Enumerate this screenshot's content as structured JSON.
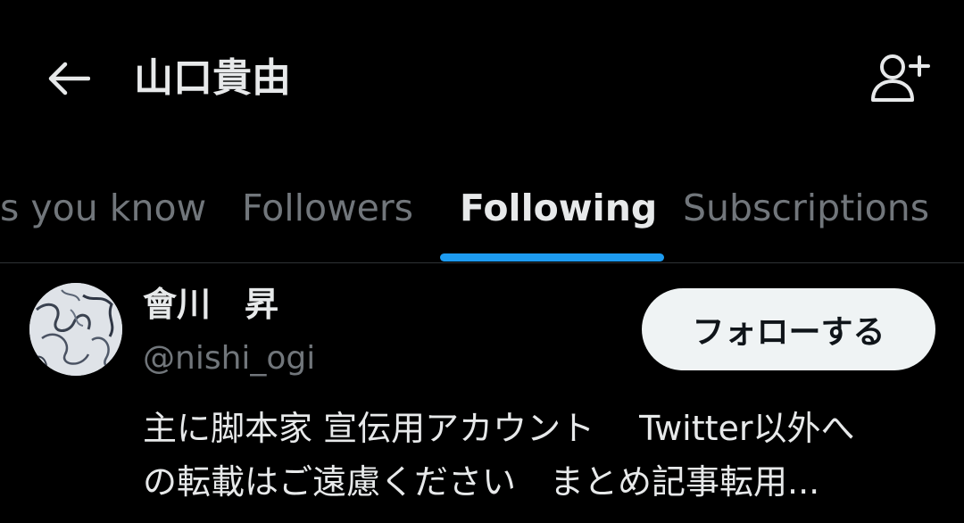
{
  "header": {
    "title": "山口貴由",
    "back_icon": "arrow-left-icon",
    "add_user_icon": "person-add-icon"
  },
  "tabs": [
    {
      "label": "s you know",
      "active": false
    },
    {
      "label": "Followers",
      "active": false
    },
    {
      "label": "Following",
      "active": true
    },
    {
      "label": "Subscriptions",
      "active": false
    }
  ],
  "user": {
    "name": "會川　昇",
    "handle": "@nishi_ogi",
    "follow_label": "フォローする",
    "bio_line1": "主に脚本家 宣伝用アカウント　 Twitter以外へ",
    "bio_line2": "の転載はご遠慮ください　まとめ記事転用..."
  },
  "colors": {
    "background": "#000000",
    "text_primary": "#e7e9ea",
    "text_secondary": "#71767b",
    "accent": "#1d9bf0",
    "button_bg": "#eff3f4"
  }
}
